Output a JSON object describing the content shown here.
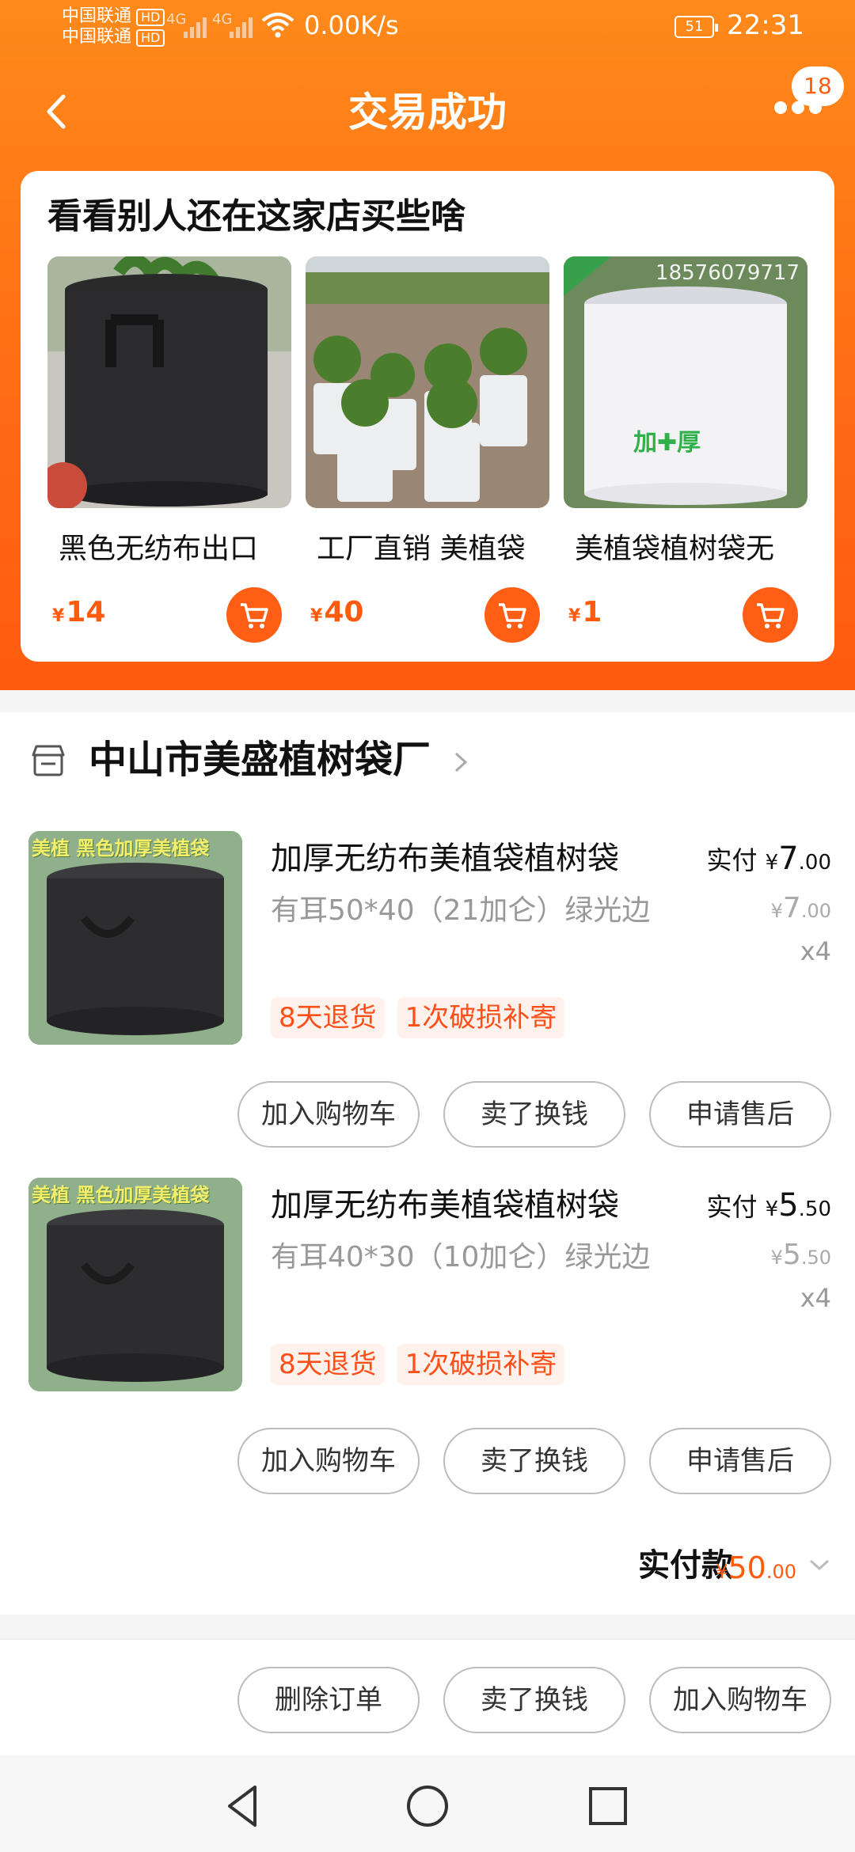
{
  "status": {
    "carrier1": "中国联通",
    "carrier2": "中国联通",
    "hd": "HD",
    "net": "4G",
    "speed": "0.00K/s",
    "battery": "51",
    "time": "22:31"
  },
  "header": {
    "title": "交易成功",
    "badge_count": "18"
  },
  "recommend": {
    "title": "看看别人还在这家店买些啥",
    "items": [
      {
        "name": "黑色无纺布出口",
        "currency": "¥",
        "price": "14"
      },
      {
        "name": "工厂直销 美植袋",
        "currency": "¥",
        "price": "40"
      },
      {
        "name": "美植袋植树袋无",
        "currency": "¥",
        "price": "1"
      }
    ],
    "item3_phone": "18576079717",
    "item3_overlay": "加✚厚"
  },
  "shop": {
    "name": "中山市美盛植树袋厂"
  },
  "products": [
    {
      "img_text": "美植 黑色加厚美植袋",
      "name": "加厚无纺布美植袋植树袋",
      "spec": "有耳50*40（21加仑）绿光边",
      "paid_label": "实付",
      "currency": "¥",
      "paid_int": "7",
      "paid_dec": ".00",
      "orig_int": "7",
      "orig_dec": ".00",
      "qty": "x4",
      "tags": [
        "8天退货",
        "1次破损补寄"
      ],
      "buttons": [
        "加入购物车",
        "卖了换钱",
        "申请售后"
      ]
    },
    {
      "img_text": "美植 黑色加厚美植袋",
      "name": "加厚无纺布美植袋植树袋",
      "spec": "有耳40*30（10加仑）绿光边",
      "paid_label": "实付",
      "currency": "¥",
      "paid_int": "5",
      "paid_dec": ".50",
      "orig_int": "5",
      "orig_dec": ".50",
      "qty": "x4",
      "tags": [
        "8天退货",
        "1次破损补寄"
      ],
      "buttons": [
        "加入购物车",
        "卖了换钱",
        "申请售后"
      ]
    }
  ],
  "total": {
    "label": "实付款",
    "currency": "¥",
    "int": "50",
    "dec": ".00"
  },
  "bottom_actions": [
    "删除订单",
    "卖了换钱",
    "加入购物车"
  ],
  "colors": {
    "accent": "#ff5b0f",
    "header_gradient_start": "#ff8a1a",
    "tag_bg": "#fff1ec"
  }
}
